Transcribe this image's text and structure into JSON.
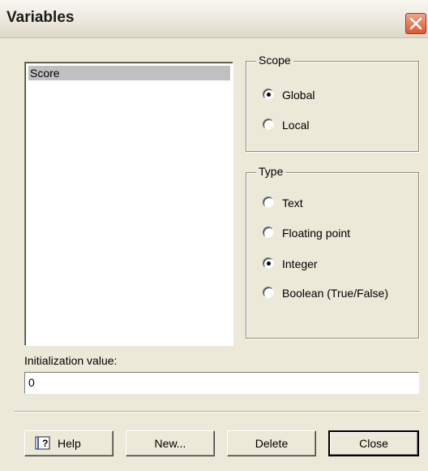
{
  "window": {
    "title": "Variables"
  },
  "variables_list": {
    "items": [
      "Score"
    ],
    "selected": "Score"
  },
  "scope_group": {
    "label": "Scope",
    "options": [
      "Global",
      "Local"
    ],
    "selected": "Global"
  },
  "type_group": {
    "label": "Type",
    "options": [
      "Text",
      "Floating point",
      "Integer",
      "Boolean (True/False)"
    ],
    "selected": "Integer"
  },
  "initialization": {
    "label": "Initialization value:",
    "value": "0"
  },
  "buttons": {
    "help": "Help",
    "new": "New...",
    "delete": "Delete",
    "close": "Close"
  },
  "icons": {
    "close": "close-icon",
    "help": "help-book-icon"
  },
  "colors": {
    "dialog_bg": "#ece9d8",
    "selection_bg": "#c0c0c0",
    "close_button": "#e0562f"
  }
}
